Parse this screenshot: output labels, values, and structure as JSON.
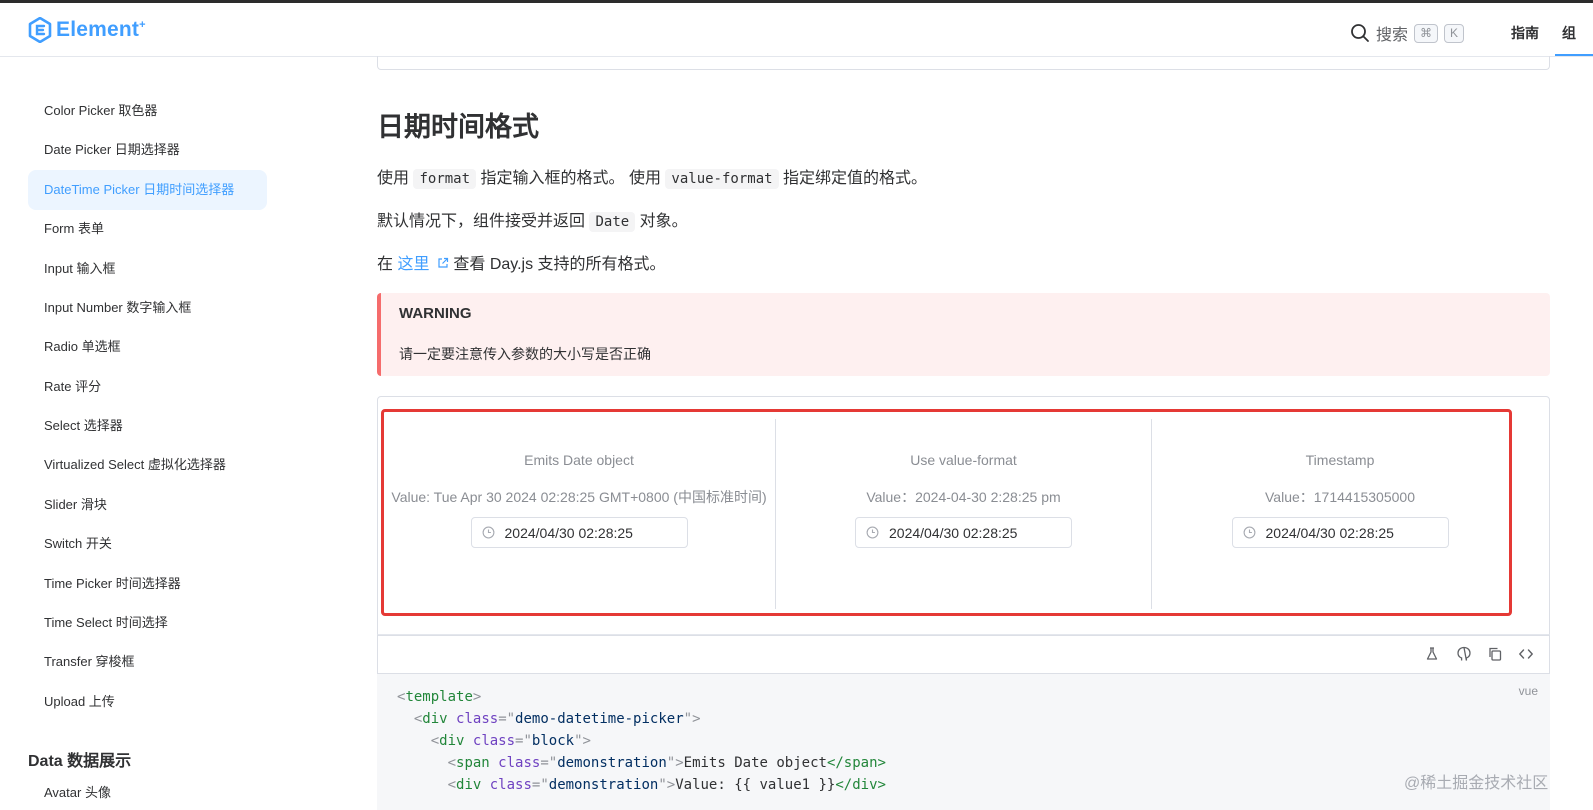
{
  "header": {
    "logo_text": "Element",
    "logo_sup": "+",
    "search_label": "搜索",
    "kbd_cmd": "⌘",
    "kbd_k": "K",
    "nav_guide": "指南",
    "nav_more": "组"
  },
  "sidebar": {
    "items": [
      {
        "label": "Color Picker 取色器"
      },
      {
        "label": "Date Picker 日期选择器"
      },
      {
        "label": "DateTime Picker 日期时间选择器",
        "active": true
      },
      {
        "label": "Form 表单"
      },
      {
        "label": "Input 输入框"
      },
      {
        "label": "Input Number 数字输入框"
      },
      {
        "label": "Radio 单选框"
      },
      {
        "label": "Rate 评分"
      },
      {
        "label": "Select 选择器"
      },
      {
        "label": "Virtualized Select 虚拟化选择器"
      },
      {
        "label": "Slider 滑块"
      },
      {
        "label": "Switch 开关"
      },
      {
        "label": "Time Picker 时间选择器"
      },
      {
        "label": "Time Select 时间选择"
      },
      {
        "label": "Transfer 穿梭框"
      },
      {
        "label": "Upload 上传"
      }
    ],
    "group_title": "Data 数据展示",
    "next_item": "Avatar 头像"
  },
  "main": {
    "heading": "日期时间格式",
    "p1": {
      "a": "使用",
      "code1": "format",
      "b": "指定输入框的格式。 使用",
      "code2": "value-format",
      "c": "指定绑定值的格式。"
    },
    "p2": {
      "a": "默认情况下，组件接受并返回",
      "code": "Date",
      "b": "对象。"
    },
    "p3": {
      "a": "在",
      "link": "这里",
      "b": "查看 Day.js 支持的所有格式。"
    },
    "warning": {
      "title": "WARNING",
      "text": "请一定要注意传入参数的大小写是否正确"
    },
    "demos": [
      {
        "title": "Emits Date object",
        "value": "Value: Tue Apr 30 2024 02:28:25 GMT+0800 (中国标准时间)",
        "input": "2024/04/30 02:28:25"
      },
      {
        "title": "Use value-format",
        "value": "Value：2024-04-30 2:28:25 pm",
        "input": "2024/04/30 02:28:25"
      },
      {
        "title": "Timestamp",
        "value": "Value：1714415305000",
        "input": "2024/04/30 02:28:25"
      }
    ],
    "code_lang": "vue",
    "code_lines": [
      {
        "indent": "",
        "open": "<",
        "tag": "template",
        "close": ">"
      },
      {
        "indent": "  ",
        "open": "<",
        "tag": "div",
        "attr": "class",
        "value": "demo-datetime-picker",
        "close": ">"
      },
      {
        "indent": "    ",
        "open": "<",
        "tag": "div",
        "attr": "class",
        "value": "block",
        "close": ">"
      },
      {
        "indent": "      ",
        "open": "<",
        "tag": "span",
        "attr": "class",
        "value": "demonstration",
        "close": ">",
        "text": "Emits Date object",
        "end": "</span>"
      },
      {
        "indent": "      ",
        "open": "<",
        "tag": "div",
        "attr": "class",
        "value": "demonstration",
        "close": ">",
        "text": "Value: {{ value1 }}",
        "end": "</div>"
      }
    ]
  },
  "watermark": "@稀土掘金技术社区",
  "colors": {
    "accent": "#409eff",
    "warning_bg": "#fef0f0",
    "warning_border": "#f56c6c",
    "highlight": "#e53935"
  }
}
